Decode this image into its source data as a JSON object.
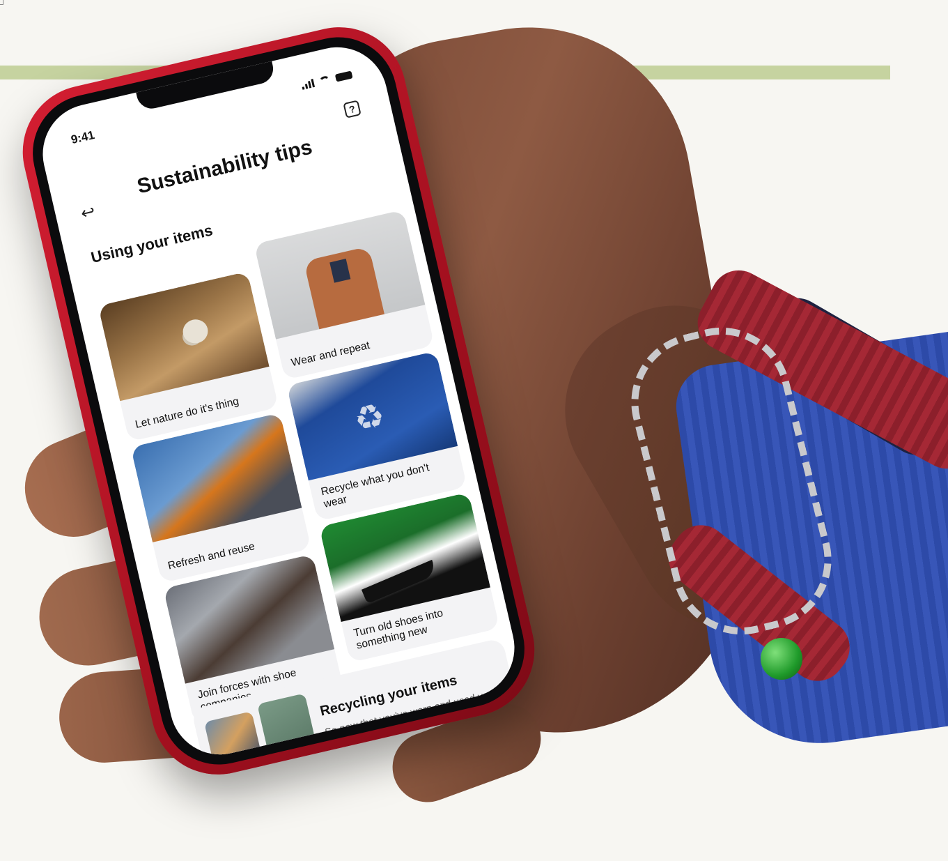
{
  "status_bar": {
    "time": "9:41"
  },
  "header": {
    "title": "Sustainability tips"
  },
  "using_section": {
    "title": "Using your items",
    "cards": [
      {
        "label": "Let nature do it's thing"
      },
      {
        "label": "Wear and repeat"
      },
      {
        "label": "Refresh and reuse"
      },
      {
        "label": "Recycle what you don't wear"
      },
      {
        "label": "Join forces with shoe companies"
      },
      {
        "label": "Turn old shoes into something new"
      }
    ]
  },
  "recycling_card": {
    "title": "Recycling your items",
    "body": "So now that you've worn and used your clothes to the fullest, explore what other sustainable options you have."
  },
  "colors": {
    "phone_frame": "#c8172b",
    "accent_band": "#c6d3a0",
    "background": "#f7f6f2"
  }
}
